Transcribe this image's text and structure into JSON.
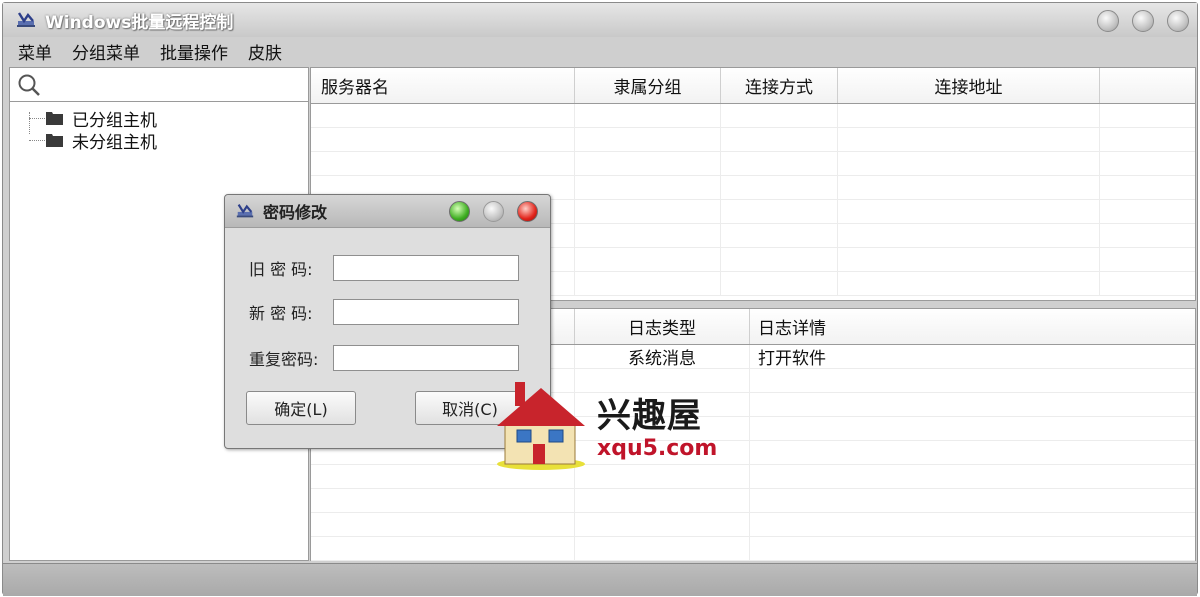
{
  "window": {
    "title": "Windows批量远程控制"
  },
  "menubar": {
    "items": [
      "菜单",
      "分组菜单",
      "批量操作",
      "皮肤"
    ]
  },
  "search": {
    "placeholder": ""
  },
  "tree": {
    "items": [
      {
        "label": "已分组主机"
      },
      {
        "label": "未分组主机"
      }
    ]
  },
  "server_table": {
    "columns": [
      "服务器名",
      "隶属分组",
      "连接方式",
      "连接地址",
      ""
    ],
    "rows": []
  },
  "log_table": {
    "columns": [
      "",
      "日志类型",
      "日志详情"
    ],
    "rows": [
      {
        "time": "",
        "type": "系统消息",
        "detail": "打开软件"
      }
    ]
  },
  "dialog": {
    "title": "密码修改",
    "old_password_label": "旧 密 码:",
    "new_password_label": "新 密 码:",
    "repeat_password_label": "重复密码:",
    "confirm_label": "确定(L)",
    "cancel_label": "取消(C)"
  },
  "watermark": {
    "name": "兴趣屋",
    "domain": "xqu5.com"
  },
  "colors": {
    "window_bg": "#cfcfcf",
    "statusbar": "#b3b3b3",
    "watermark_red": "#c0142a"
  }
}
